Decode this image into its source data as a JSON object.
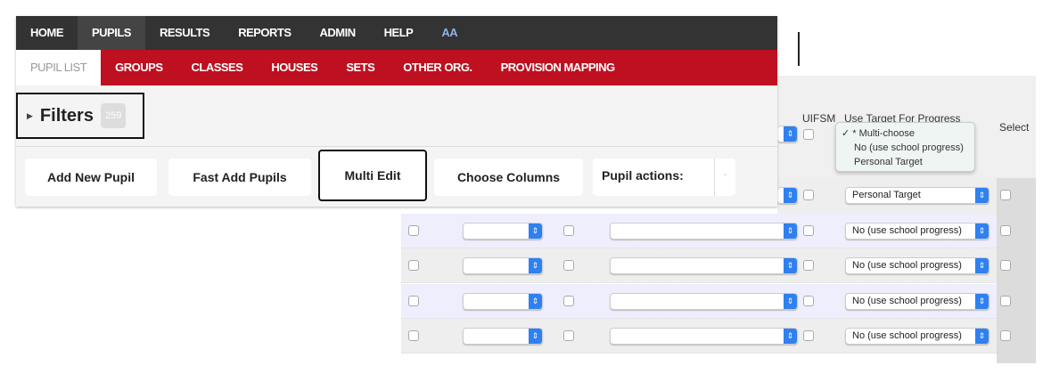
{
  "nav": {
    "items": [
      {
        "label": "HOME"
      },
      {
        "label": "PUPILS",
        "active": true
      },
      {
        "label": "RESULTS"
      },
      {
        "label": "REPORTS"
      },
      {
        "label": "ADMIN"
      },
      {
        "label": "HELP"
      },
      {
        "label": "AA"
      }
    ]
  },
  "subnav": {
    "items": [
      {
        "label": "PUPIL LIST",
        "active": true
      },
      {
        "label": "GROUPS"
      },
      {
        "label": "CLASSES"
      },
      {
        "label": "HOUSES"
      },
      {
        "label": "SETS"
      },
      {
        "label": "OTHER ORG."
      },
      {
        "label": "PROVISION MAPPING"
      }
    ]
  },
  "filters": {
    "label": "Filters",
    "count": "259"
  },
  "buttons": {
    "add_new": "Add New Pupil",
    "fast_add": "Fast Add Pupils",
    "multi_edit": "Multi Edit",
    "choose_columns": "Choose Columns",
    "pupil_actions": "Pupil actions:",
    "pupil_actions_value": "-"
  },
  "table": {
    "headers": {
      "uifsm": "UIFSM",
      "target": "Use Target For Progress",
      "select": "Select"
    },
    "dropdown": {
      "options": [
        "* Multi-choose",
        "No (use school progress)",
        "Personal Target"
      ],
      "selected": "* Multi-choose",
      "check": "✓"
    },
    "first_row_target": "Personal Target",
    "rows": [
      {
        "target": "No (use school progress)"
      },
      {
        "target": "No (use school progress)"
      },
      {
        "target": "No (use school progress)"
      },
      {
        "target": "No (use school progress)"
      }
    ]
  },
  "colors": {
    "nav": "#333333",
    "subnav": "#be1020",
    "select_arrow": "#2f80f0"
  }
}
